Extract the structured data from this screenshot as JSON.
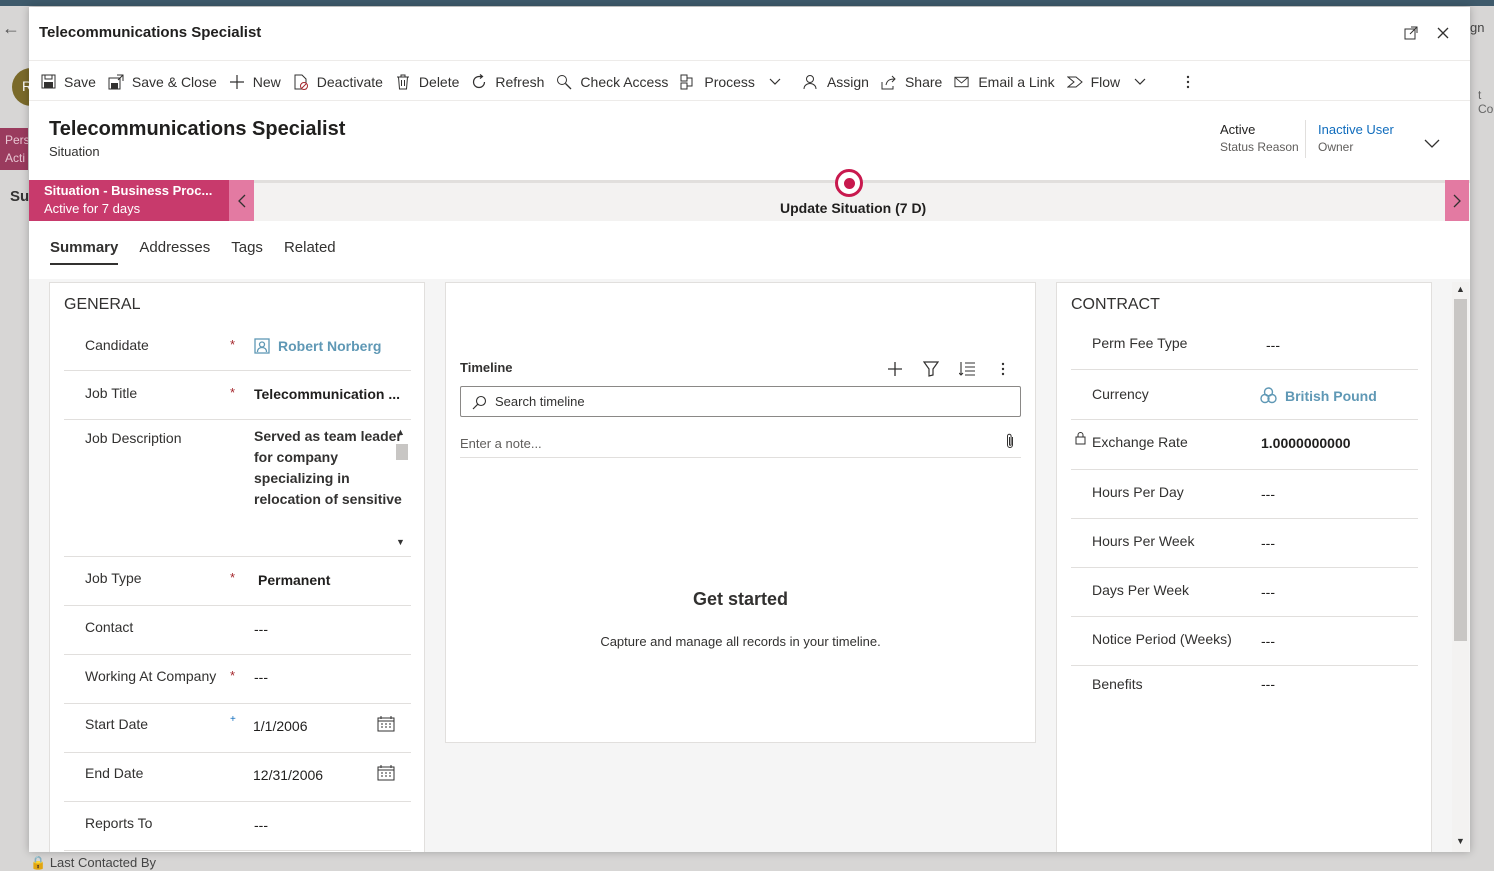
{
  "background": {
    "pers_text": "Pers",
    "acti_text": "Acti",
    "su_text": "Su",
    "avatar_letter": "R",
    "gn_text": "gn",
    "tco_text": "t Co",
    "last_contacted": "Last Contacted By"
  },
  "modal": {
    "title": "Telecommunications Specialist"
  },
  "commands": {
    "save": "Save",
    "save_close": "Save & Close",
    "new": "New",
    "deactivate": "Deactivate",
    "delete": "Delete",
    "refresh": "Refresh",
    "check_access": "Check Access",
    "process": "Process",
    "assign": "Assign",
    "share": "Share",
    "email_link": "Email a Link",
    "flow": "Flow"
  },
  "record": {
    "title": "Telecommunications Specialist",
    "entity": "Situation",
    "status_value": "Active",
    "status_label": "Status Reason",
    "owner_value": "Inactive User",
    "owner_label": "Owner"
  },
  "bpf": {
    "stage_name": "Situation - Business Proc...",
    "stage_duration": "Active for 7 days",
    "active_label": "Update Situation  (7 D)"
  },
  "tabs": [
    "Summary",
    "Addresses",
    "Tags",
    "Related"
  ],
  "general": {
    "title": "GENERAL",
    "candidate_label": "Candidate",
    "candidate_value": "Robert Norberg",
    "job_title_label": "Job Title",
    "job_title_value": "Telecommunication ...",
    "job_description_label": "Job Description",
    "job_description_value": "Served as team leader for company specializing in relocation of sensitive",
    "job_type_label": "Job Type",
    "job_type_value": "Permanent",
    "contact_label": "Contact",
    "contact_value": "---",
    "working_at_label": "Working At Company",
    "working_at_value": "---",
    "start_date_label": "Start Date",
    "start_date_value": "1/1/2006",
    "end_date_label": "End Date",
    "end_date_value": "12/31/2006",
    "reports_to_label": "Reports To",
    "reports_to_value": "---",
    "required_mark": "*",
    "recommended_mark": "+"
  },
  "timeline": {
    "title": "Timeline",
    "search_placeholder": "Search timeline",
    "note_placeholder": "Enter a note...",
    "get_started": "Get started",
    "get_started_desc": "Capture and manage all records in your timeline."
  },
  "contract": {
    "title": "CONTRACT",
    "perm_fee_label": "Perm Fee Type",
    "perm_fee_value": "---",
    "currency_label": "Currency",
    "currency_value": "British Pound",
    "exchange_rate_label": "Exchange Rate",
    "exchange_rate_value": "1.0000000000",
    "hours_day_label": "Hours Per Day",
    "hours_day_value": "---",
    "hours_week_label": "Hours Per Week",
    "hours_week_value": "---",
    "days_week_label": "Days Per Week",
    "days_week_value": "---",
    "notice_label": "Notice Period (Weeks)",
    "notice_value": "---",
    "benefits_label": "Benefits",
    "benefits_value": "---"
  },
  "colors": {
    "bpf_active": "#c83a6c",
    "bpf_nav": "#e37aa2",
    "link": "#0f6cbd",
    "lookup": "#5f98b5",
    "required": "#a4262c"
  }
}
